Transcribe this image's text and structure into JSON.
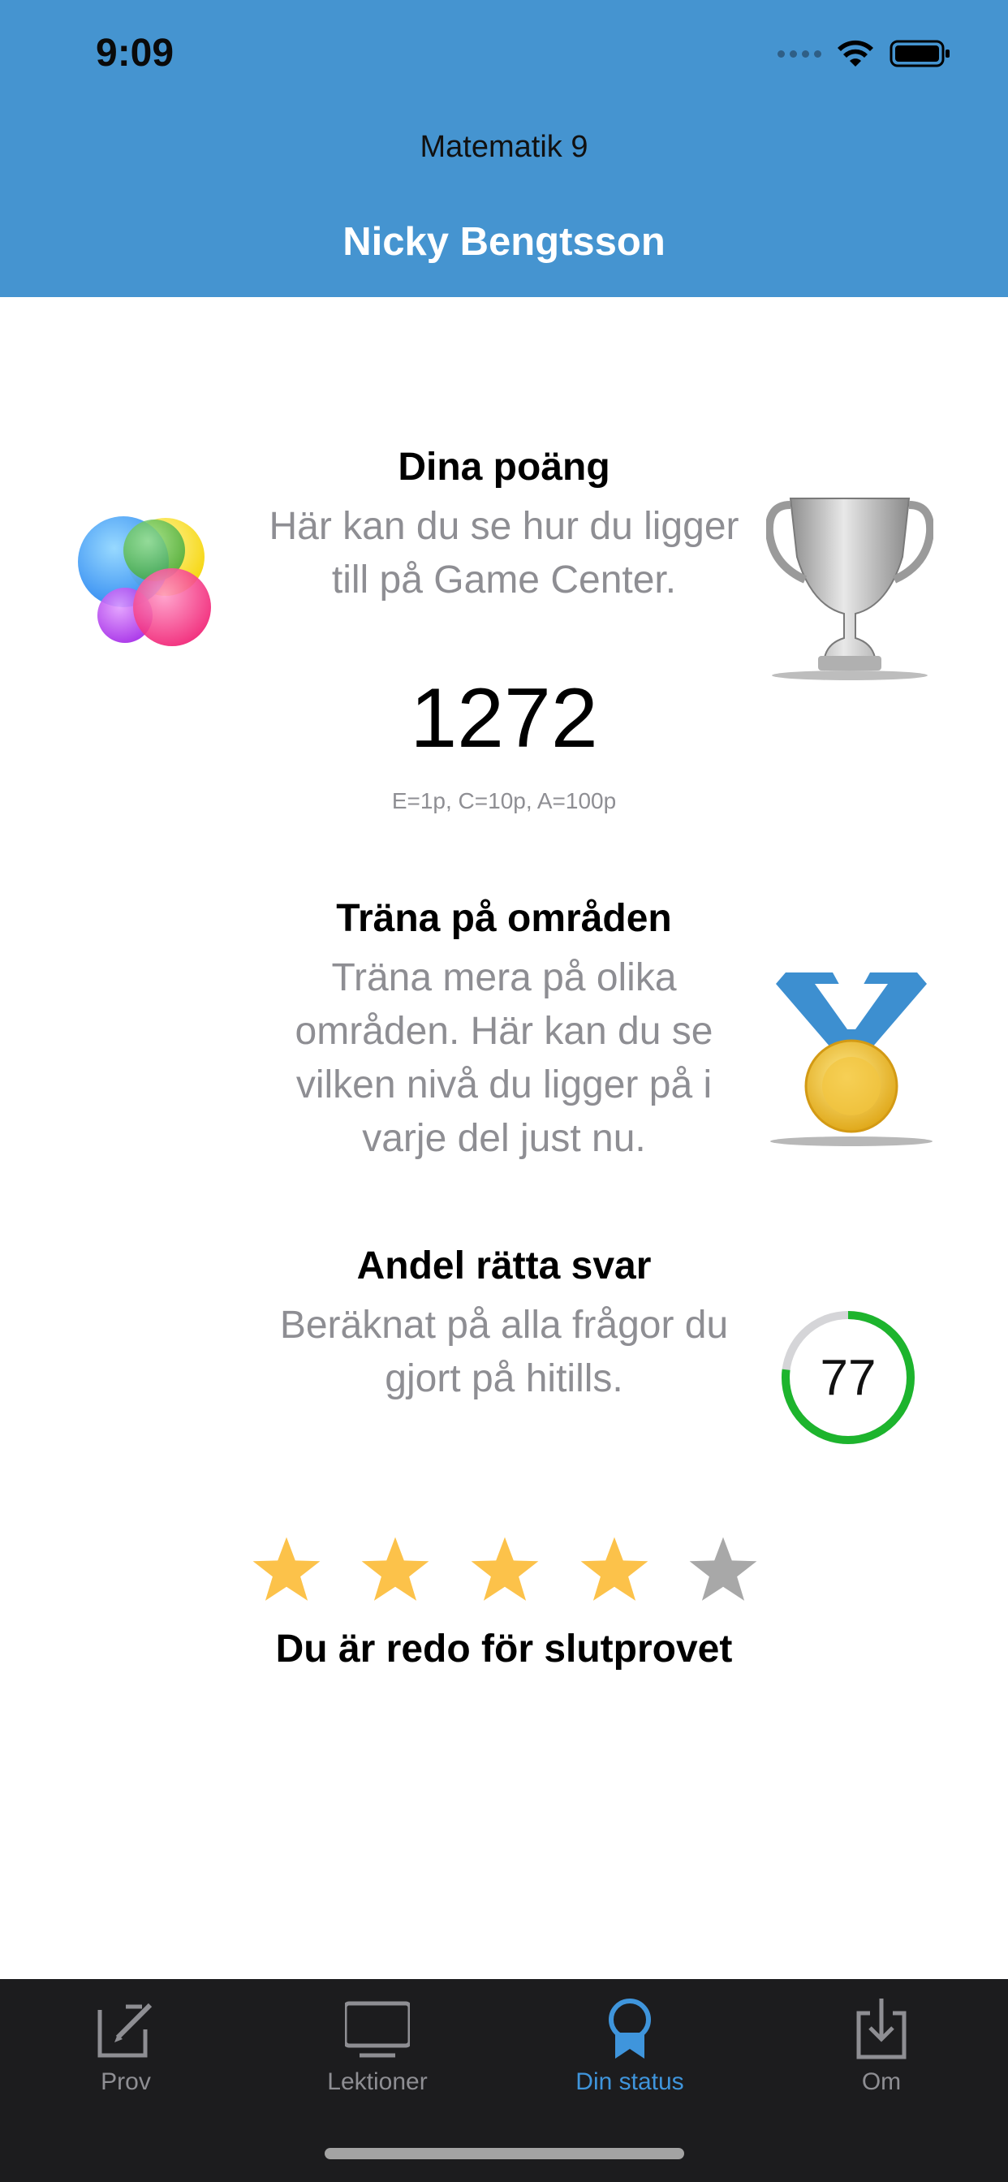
{
  "status_bar": {
    "time": "9:09",
    "signal_icon": "signal-dots-icon",
    "wifi_icon": "wifi-icon",
    "battery_icon": "battery-icon"
  },
  "header": {
    "subtitle": "Matematik 9",
    "title": "Nicky Bengtsson",
    "background_color": "#4594d0"
  },
  "sections": {
    "points": {
      "title": "Dina poäng",
      "description": "Här kan du se hur du ligger till på Game Center.",
      "value": "1272",
      "legend": "E=1p, C=10p, A=100p",
      "left_icon": "game-center-icon",
      "right_icon": "trophy-icon"
    },
    "areas": {
      "title": "Träna på områden",
      "description": "Träna mera på olika områden. Här kan du se vilken nivå du ligger på i varje del just nu.",
      "right_icon": "medal-icon"
    },
    "correct": {
      "title": "Andel rätta svar",
      "description": "Beräknat på alla frågor du gjort på hitills.",
      "value": "77",
      "progress": 0.77,
      "gauge_color": "#1db42d"
    }
  },
  "rating": {
    "stars_filled": 4,
    "stars_total": 5,
    "message": "Du är redo för slutprovet",
    "filled_color": "#fcc24a",
    "empty_color": "#a8a8a8"
  },
  "tabbar": {
    "tabs": [
      {
        "label": "Prov",
        "icon": "edit-icon",
        "active": false
      },
      {
        "label": "Lektioner",
        "icon": "tv-icon",
        "active": false
      },
      {
        "label": "Din status",
        "icon": "ribbon-icon",
        "active": true
      },
      {
        "label": "Om",
        "icon": "download-icon",
        "active": false
      }
    ],
    "active_color": "#3f95dc",
    "inactive_color": "#8e8e93"
  }
}
